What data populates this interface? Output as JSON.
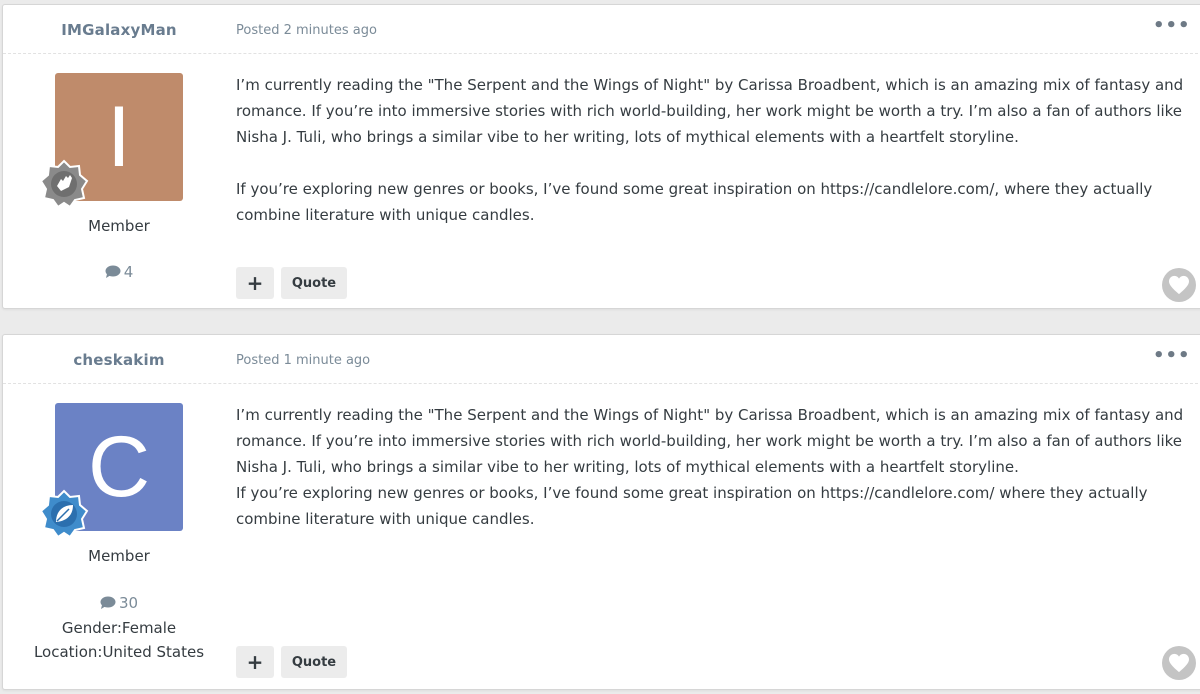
{
  "posts": [
    {
      "author": "IMGalaxyMan",
      "posted": "Posted 2 minutes ago",
      "avatar_letter": "I",
      "avatar_color": "#bf8b6b",
      "group": "Member",
      "post_count": "4",
      "paragraphs": [
        "I’m currently reading the \"The Serpent and the Wings of Night\" by Carissa Broadbent, which is an amazing mix of fantasy and romance. If you’re into immersive stories with rich world-building, her work might be worth a try. I’m also a fan of authors like Nisha J. Tuli, who brings a similar vibe to her writing, lots of mythical elements with a heartfelt storyline.",
        "If you’re exploring new genres or books, I’ve found some great inspiration on https://candlelore.com/, where they actually combine literature with unique candles."
      ],
      "plus_label": "+",
      "quote_label": "Quote",
      "more_label": "•••"
    },
    {
      "author": "cheskakim",
      "posted": "Posted 1 minute ago",
      "avatar_letter": "C",
      "avatar_color": "#6b82c5",
      "group": "Member",
      "post_count": "30",
      "gender": "Gender:Female",
      "location": "Location:United States",
      "paragraphs": [
        "I’m currently reading the \"The Serpent and the Wings of Night\" by Carissa Broadbent, which is an amazing mix of fantasy and romance. If you’re into immersive stories with rich world-building, her work might be worth a try. I’m also a fan of authors like Nisha J. Tuli, who brings a similar vibe to her writing, lots of mythical elements with a heartfelt storyline.",
        "If you’re exploring new genres or books, I’ve found some great inspiration on https://candlelore.com/ where they actually combine literature with unique candles."
      ],
      "plus_label": "+",
      "quote_label": "Quote",
      "more_label": "•••"
    }
  ],
  "icons": {
    "comment": "comment-icon",
    "heart": "heart-icon",
    "rank_badge_1": "hand-badge-icon",
    "rank_badge_2": "leaf-badge-icon"
  }
}
